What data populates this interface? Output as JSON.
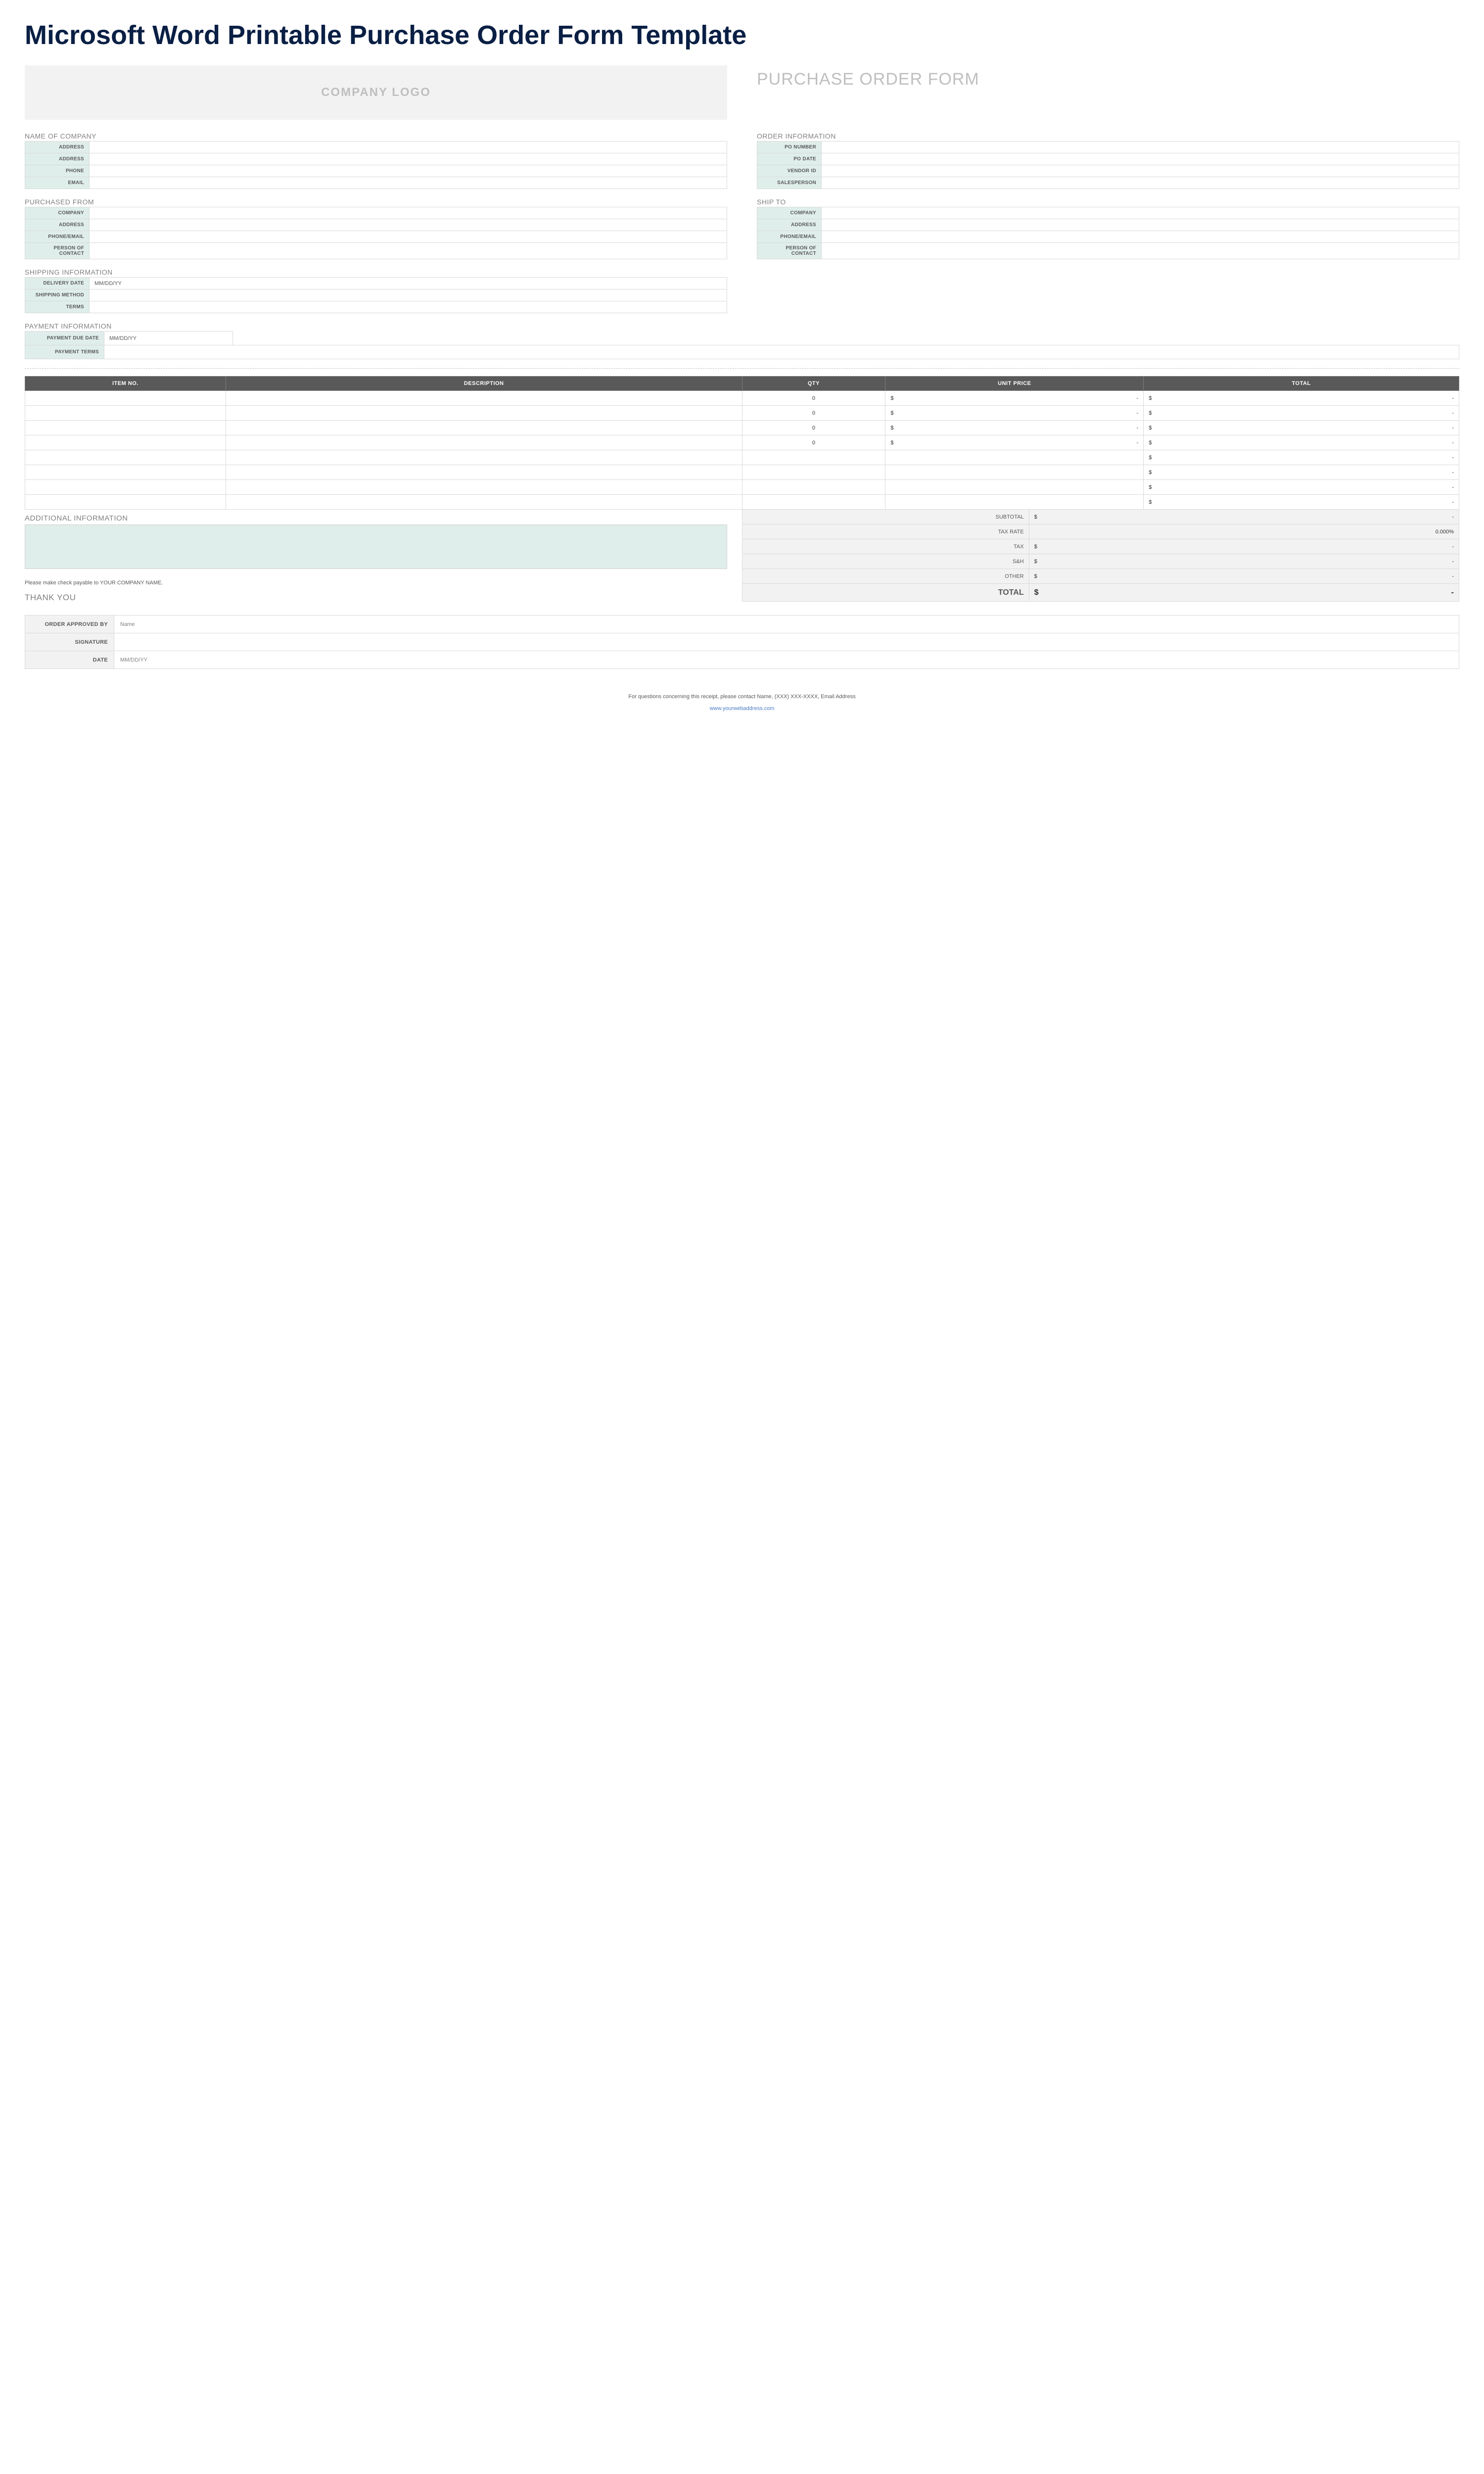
{
  "title": "Microsoft Word Printable Purchase Order Form Template",
  "header": {
    "logo_placeholder": "COMPANY LOGO",
    "form_title": "PURCHASE ORDER FORM"
  },
  "company": {
    "section_label": "NAME OF COMPANY",
    "rows": [
      {
        "label": "ADDRESS",
        "value": ""
      },
      {
        "label": "ADDRESS",
        "value": ""
      },
      {
        "label": "PHONE",
        "value": ""
      },
      {
        "label": "EMAIL",
        "value": ""
      }
    ]
  },
  "order_info": {
    "section_label": "ORDER INFORMATION",
    "rows": [
      {
        "label": "PO NUMBER",
        "value": ""
      },
      {
        "label": "PO DATE",
        "value": ""
      },
      {
        "label": "VENDOR ID",
        "value": ""
      },
      {
        "label": "SALESPERSON",
        "value": ""
      }
    ]
  },
  "purchased_from": {
    "section_label": "PURCHASED FROM",
    "rows": [
      {
        "label": "COMPANY",
        "value": ""
      },
      {
        "label": "ADDRESS",
        "value": ""
      },
      {
        "label": "PHONE/EMAIL",
        "value": ""
      },
      {
        "label": "PERSON OF CONTACT",
        "value": ""
      }
    ]
  },
  "ship_to": {
    "section_label": "SHIP TO",
    "rows": [
      {
        "label": "COMPANY",
        "value": ""
      },
      {
        "label": "ADDRESS",
        "value": ""
      },
      {
        "label": "PHONE/EMAIL",
        "value": ""
      },
      {
        "label": "PERSON OF CONTACT",
        "value": ""
      }
    ]
  },
  "shipping": {
    "section_label": "SHIPPING INFORMATION",
    "rows": [
      {
        "label": "DELIVERY DATE",
        "value": "MM/DD/YY"
      },
      {
        "label": "SHIPPING METHOD",
        "value": ""
      },
      {
        "label": "TERMS",
        "value": ""
      }
    ]
  },
  "payment": {
    "section_label": "PAYMENT INFORMATION",
    "rows": [
      {
        "label": "PAYMENT DUE DATE",
        "value": "MM/DD/YY"
      },
      {
        "label": "PAYMENT TERMS",
        "value": ""
      }
    ]
  },
  "items": {
    "headers": {
      "item_no": "ITEM NO.",
      "description": "DESCRIPTION",
      "qty": "QTY",
      "unit_price": "UNIT PRICE",
      "total": "TOTAL"
    },
    "rows": [
      {
        "item_no": "",
        "description": "",
        "qty": "0",
        "unit_price_sym": "$",
        "unit_price_val": "-",
        "total_sym": "$",
        "total_val": "-"
      },
      {
        "item_no": "",
        "description": "",
        "qty": "0",
        "unit_price_sym": "$",
        "unit_price_val": "-",
        "total_sym": "$",
        "total_val": "-"
      },
      {
        "item_no": "",
        "description": "",
        "qty": "0",
        "unit_price_sym": "$",
        "unit_price_val": "-",
        "total_sym": "$",
        "total_val": "-"
      },
      {
        "item_no": "",
        "description": "",
        "qty": "0",
        "unit_price_sym": "$",
        "unit_price_val": "-",
        "total_sym": "$",
        "total_val": "-"
      },
      {
        "item_no": "",
        "description": "",
        "qty": "",
        "unit_price_sym": "",
        "unit_price_val": "",
        "total_sym": "$",
        "total_val": "-"
      },
      {
        "item_no": "",
        "description": "",
        "qty": "",
        "unit_price_sym": "",
        "unit_price_val": "",
        "total_sym": "$",
        "total_val": "-"
      },
      {
        "item_no": "",
        "description": "",
        "qty": "",
        "unit_price_sym": "",
        "unit_price_val": "",
        "total_sym": "$",
        "total_val": "-"
      },
      {
        "item_no": "",
        "description": "",
        "qty": "",
        "unit_price_sym": "",
        "unit_price_val": "",
        "total_sym": "$",
        "total_val": "-"
      }
    ]
  },
  "additional": {
    "label": "ADDITIONAL INFORMATION",
    "check_note": "Please make check payable to YOUR COMPANY NAME.",
    "thank_you": "THANK YOU"
  },
  "totals": {
    "rows": [
      {
        "label": "SUBTOTAL",
        "sym": "$",
        "val": "-"
      },
      {
        "label": "TAX RATE",
        "sym": "",
        "val": "0.000%"
      },
      {
        "label": "TAX",
        "sym": "$",
        "val": "-"
      },
      {
        "label": "S&H",
        "sym": "$",
        "val": "-"
      },
      {
        "label": "OTHER",
        "sym": "$",
        "val": "-"
      }
    ],
    "grand": {
      "label": "TOTAL",
      "sym": "$",
      "val": "-"
    }
  },
  "approval": {
    "rows": [
      {
        "label": "ORDER APPROVED BY",
        "value": "Name"
      },
      {
        "label": "SIGNATURE",
        "value": ""
      },
      {
        "label": "DATE",
        "value": "MM/DD/YY"
      }
    ]
  },
  "footer": {
    "contact": "For questions concerning this receipt, please contact Name, (XXX) XXX-XXXX, Email Address",
    "link": "www.yourwebaddress.com"
  }
}
